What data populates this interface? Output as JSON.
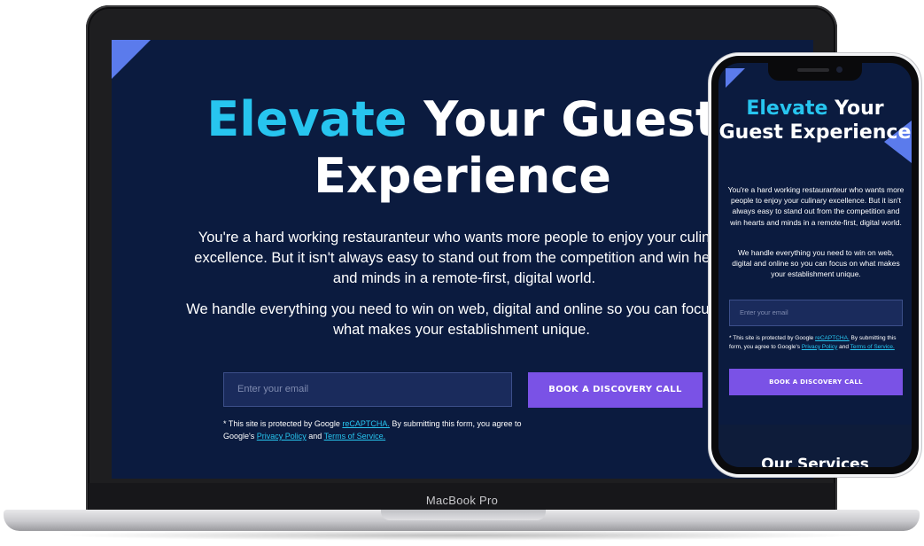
{
  "laptop": {
    "brand_label": "MacBook Pro",
    "hero": {
      "title_accent": "Elevate",
      "title_rest": " Your Guest Experience",
      "paragraph_1": "You're a hard working restauranteur who wants more people to enjoy your culinary excellence. But it isn't always easy to stand out from the competition and win hearts and minds in a remote-first, digital world.",
      "paragraph_2": "We handle everything you need to win on web, digital and online so you can focus on what makes your establishment unique."
    },
    "form": {
      "email_placeholder": "Enter your email",
      "cta_label": "BOOK A DISCOVERY CALL",
      "notice_prefix": "* This site is protected by Google ",
      "notice_recaptcha": "reCAPTCHA.",
      "notice_middle": " By submitting this form, you agree to Google's ",
      "notice_privacy": "Privacy Policy",
      "notice_and": " and ",
      "notice_terms": "Terms of Service."
    }
  },
  "phone": {
    "hero": {
      "title_accent": "Elevate",
      "title_rest": " Your Guest Experience",
      "paragraph_1": "You're a hard working restauranteur who wants more people to enjoy your culinary excellence. But it isn't always easy to stand out from the competition and win hearts and minds in a remote-first, digital world.",
      "paragraph_2": "We handle everything you need to win on web, digital and online so you can focus on what makes your establishment unique."
    },
    "form": {
      "email_placeholder": "Enter your email",
      "notice_prefix": "* This site is protected by Google ",
      "notice_recaptcha": "reCAPTCHA.",
      "notice_middle": " By submitting this form, you agree to Google's ",
      "notice_privacy": "Privacy Policy",
      "notice_and": " and ",
      "notice_terms": "Terms of Service.",
      "cta_label": "BOOK A DISCOVERY CALL"
    },
    "next_section_title": "Our Services"
  },
  "colors": {
    "background": "#0b1b3f",
    "accent_cyan": "#27c5ef",
    "cta_purple": "#7a52e6",
    "corner_blue": "#5b7bec"
  }
}
